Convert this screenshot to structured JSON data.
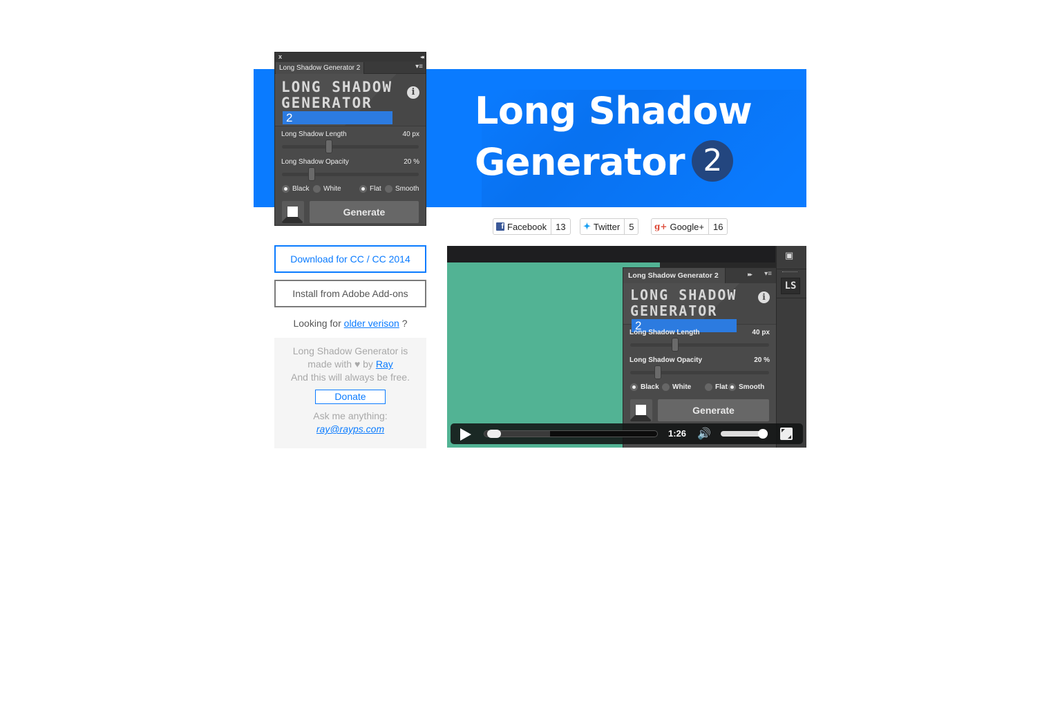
{
  "banner": {
    "title_line1": "Long Shadow",
    "title_line2": "Generator",
    "version_badge": "2",
    "color": "#0a7bff"
  },
  "panel": {
    "close_glyph": "x",
    "collapse_glyph": "◂◂",
    "tab_label": "Long Shadow Generator 2",
    "menu_glyph": "▾≡",
    "logo_line1": "LONG SHADOW",
    "logo_line2": "GENERATOR",
    "logo_version": "2",
    "info_glyph": "i",
    "length_label": "Long Shadow Length",
    "length_value": "40 px",
    "length_fraction": 0.33,
    "opacity_label": "Long Shadow Opacity",
    "opacity_value": "20 %",
    "opacity_fraction": 0.2,
    "color_options": [
      {
        "label": "Black",
        "selected": true
      },
      {
        "label": "White",
        "selected": false
      }
    ],
    "style_options": [
      {
        "label": "Flat",
        "selected": true
      },
      {
        "label": "Smooth",
        "selected": false
      }
    ],
    "generate_label": "Generate"
  },
  "social": [
    {
      "name": "Facebook",
      "icon": "f",
      "count": "13"
    },
    {
      "name": "Twitter",
      "icon": "🐦",
      "count": "5"
    },
    {
      "name": "Google+",
      "icon": "g+",
      "count": "16"
    }
  ],
  "left": {
    "download_label": "Download for CC / CC 2014",
    "install_label": "Install from Adobe Add-ons",
    "older_prefix": "Looking for",
    "older_link": "older verison",
    "older_suffix": "?"
  },
  "about": {
    "line1": "Long Shadow Generator is",
    "line2_prefix": "made with ♥ by",
    "author_link": "Ray",
    "line3": "And this will always be free.",
    "donate_label": "Donate",
    "ask_label": "Ask me anything:",
    "email": "ray@rayps.com"
  },
  "video": {
    "panel_tab": "Long Shadow Generator 2",
    "forward_glyph": "▸▸",
    "menu_glyph": "▾≡",
    "logo_line1": "LONG SHADOW",
    "logo_line2": "GENERATOR",
    "logo_version": "2",
    "info_glyph": "i",
    "length_label": "Long Shadow Length",
    "length_value": "40 px",
    "opacity_label": "Long Shadow Opacity",
    "opacity_value": "20 %",
    "color_options": [
      {
        "label": "Black",
        "selected": true
      },
      {
        "label": "White",
        "selected": false
      }
    ],
    "style_options": [
      {
        "label": "Flat",
        "selected": false
      },
      {
        "label": "Smooth",
        "selected": true
      }
    ],
    "generate_label": "Generate",
    "sidebar_ls": "LS",
    "time": "1:26",
    "played_fraction": 0.02,
    "buffered_fraction": 0.38,
    "volume_fraction": 0.9,
    "volume_glyph": "🔊"
  }
}
